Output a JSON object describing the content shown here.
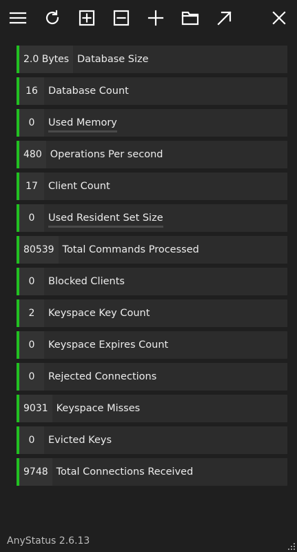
{
  "toolbar": {
    "buttons": [
      {
        "icon": "menu-icon"
      },
      {
        "icon": "refresh-icon"
      },
      {
        "icon": "expand-all-icon"
      },
      {
        "icon": "collapse-all-icon"
      },
      {
        "icon": "add-icon"
      },
      {
        "icon": "folder-icon"
      },
      {
        "icon": "open-external-icon"
      },
      {
        "icon": "close-icon"
      }
    ]
  },
  "accent_color": "#22c022",
  "items": [
    {
      "value": "2.0 Bytes",
      "label": "Database Size",
      "progress": false
    },
    {
      "value": "16",
      "label": "Database Count",
      "progress": false
    },
    {
      "value": "0",
      "label": "Used Memory",
      "progress": true
    },
    {
      "value": "480",
      "label": "Operations Per second",
      "progress": false
    },
    {
      "value": "17",
      "label": "Client Count",
      "progress": false
    },
    {
      "value": "0",
      "label": "Used Resident Set Size",
      "progress": true
    },
    {
      "value": "80539",
      "label": "Total Commands Processed",
      "progress": false
    },
    {
      "value": "0",
      "label": "Blocked Clients",
      "progress": false
    },
    {
      "value": "2",
      "label": "Keyspace Key Count",
      "progress": false
    },
    {
      "value": "0",
      "label": "Keyspace Expires Count",
      "progress": false
    },
    {
      "value": "0",
      "label": "Rejected Connections",
      "progress": false
    },
    {
      "value": "9031",
      "label": "Keyspace Misses",
      "progress": false
    },
    {
      "value": "0",
      "label": "Evicted Keys",
      "progress": false
    },
    {
      "value": "9748",
      "label": "Total Connections Received",
      "progress": false
    }
  ],
  "footer": {
    "version": "AnyStatus 2.6.13"
  }
}
